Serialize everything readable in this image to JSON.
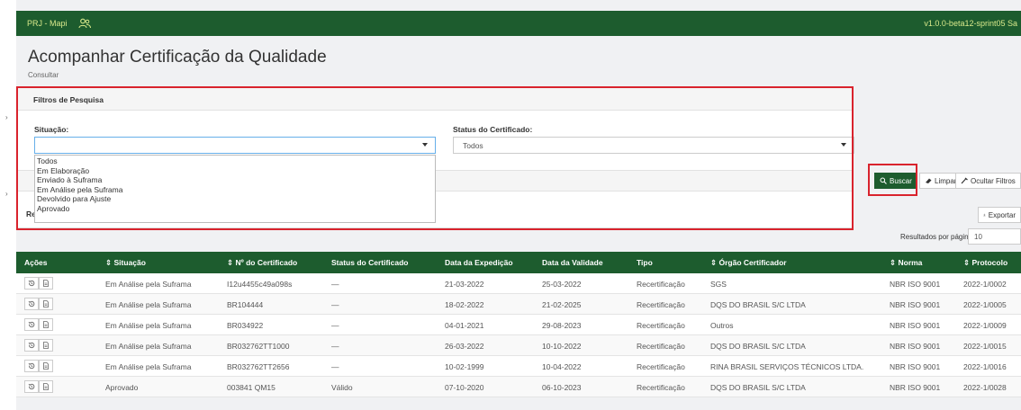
{
  "header": {
    "brand": "PRJ - Mapi",
    "version": "v1.0.0-beta12-sprint05 Sa"
  },
  "page": {
    "title": "Acompanhar Certificação da Qualidade",
    "subtitle": "Consultar"
  },
  "filters": {
    "title": "Filtros de Pesquisa",
    "situacao_label": "Situação:",
    "situacao_value": "",
    "situacao_options": [
      "Todos",
      "Em Elaboração",
      "Enviado à Suframa",
      "Em Análise pela Suframa",
      "Devolvido para Ajuste",
      "Aprovado"
    ],
    "status_label": "Status do Certificado:",
    "status_value": "Todos"
  },
  "results_peek": "Re",
  "buttons": {
    "search": "Buscar",
    "clear": "Limpar",
    "hide_filters": "Ocultar Filtros",
    "export": "Exportar"
  },
  "pagination": {
    "label": "Resultados por página:",
    "value": "10"
  },
  "table": {
    "columns": [
      "Ações",
      "⇕ Situação",
      "⇕ Nº do Certificado",
      "Status do Certificado",
      "Data da Expedição",
      "Data da Validade",
      "Tipo",
      "⇕ Órgão Certificador",
      "⇕ Norma",
      "⇕ Protocolo"
    ],
    "rows": [
      [
        "Em Análise pela Suframa",
        "I12u4455c49a098s",
        "—",
        "21-03-2022",
        "25-03-2022",
        "Recertificação",
        "SGS",
        "NBR ISO 9001",
        "2022-1/0002"
      ],
      [
        "Em Análise pela Suframa",
        "BR104444",
        "—",
        "18-02-2022",
        "21-02-2025",
        "Recertificação",
        "DQS DO BRASIL S/C LTDA",
        "NBR ISO 9001",
        "2022-1/0005"
      ],
      [
        "Em Análise pela Suframa",
        "BR034922",
        "—",
        "04-01-2021",
        "29-08-2023",
        "Recertificação",
        "Outros",
        "NBR ISO 9001",
        "2022-1/0009"
      ],
      [
        "Em Análise pela Suframa",
        "BR032762TT1000",
        "—",
        "26-03-2022",
        "10-10-2022",
        "Recertificação",
        "DQS DO BRASIL S/C LTDA",
        "NBR ISO 9001",
        "2022-1/0015"
      ],
      [
        "Em Análise pela Suframa",
        "BR032762TT2656",
        "—",
        "10-02-1999",
        "10-04-2022",
        "Recertificação",
        "RINA BRASIL SERVIÇOS TÉCNICOS LTDA.",
        "NBR ISO 9001",
        "2022-1/0016"
      ],
      [
        "Aprovado",
        "003841 QM15",
        "Válido",
        "07-10-2020",
        "06-10-2023",
        "Recertificação",
        "DQS DO BRASIL S/C LTDA",
        "NBR ISO 9001",
        "2022-1/0028"
      ]
    ]
  },
  "colors": {
    "header_green": "#1d5c2e",
    "highlight_red": "#d9232d",
    "brand_yellow": "#d9e98b"
  },
  "icons": {
    "users": "users-icon",
    "search": "search-icon",
    "eraser": "eraser-icon",
    "filter": "filter-off-icon",
    "export": "download-icon",
    "history": "history-icon",
    "document": "document-icon"
  }
}
